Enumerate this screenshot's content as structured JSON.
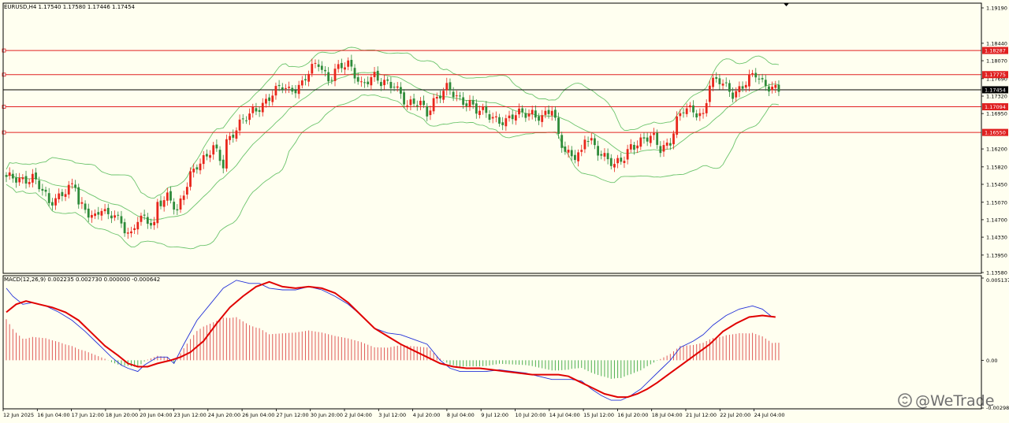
{
  "colors": {
    "background": "#fffff0",
    "border": "#000000",
    "bull": "#e8261c",
    "bear": "#2e8b3a",
    "band": "#6cc46c",
    "level": "#e02020",
    "price_line": "#000000",
    "macd_fast": "#2230d8",
    "macd_slow": "#e00000",
    "hist_pos": "#e05a5a",
    "hist_neg": "#4caf50"
  },
  "watermark": "@WeTrade",
  "watermark_icon": "wetrade-logo-icon",
  "chart_data": [
    {
      "type": "candlestick",
      "header": "EURUSD,H4  1.17540 1.17580 1.17446 1.17454",
      "ylim": [
        1.1358,
        1.1919
      ],
      "y_ticks": [
        "1.19190",
        "1.18440",
        "1.18070",
        "1.17690",
        "1.17320",
        "1.16950",
        "1.16200",
        "1.15820",
        "1.15450",
        "1.15070",
        "1.14700",
        "1.14330",
        "1.13950",
        "1.13580"
      ],
      "levels": [
        {
          "label": "1.18287",
          "value": 1.18287
        },
        {
          "label": "1.17775",
          "value": 1.17775
        },
        {
          "label": "1.17094",
          "value": 1.17094
        },
        {
          "label": "1.16550",
          "value": 1.1655
        }
      ],
      "current_price": {
        "label": "1.17454",
        "value": 1.17454
      },
      "bollinger_bands": true,
      "x_labels": [
        "12 Jun 2025",
        "16 Jun 04:00",
        "17 Jun 12:00",
        "18 Jun 20:00",
        "20 Jun 04:00",
        "23 Jun 12:00",
        "24 Jun 20:00",
        "26 Jun 04:00",
        "27 Jun 12:00",
        "30 Jun 20:00",
        "2 Jul 04:00",
        "3 Jul 12:00",
        "4 Jul 20:00",
        "8 Jul 04:00",
        "9 Jul 12:00",
        "10 Jul 20:00",
        "14 Jul 04:00",
        "15 Jul 12:00",
        "16 Jul 20:00",
        "18 Jul 04:00",
        "21 Jul 12:00",
        "22 Jul 20:00",
        "24 Jul 04:00"
      ],
      "close_path": [
        [
          0,
          1.1555
        ],
        [
          8,
          1.156
        ],
        [
          13,
          1.1505
        ],
        [
          17,
          1.153
        ],
        [
          21,
          1.154
        ],
        [
          22,
          1.15
        ],
        [
          27,
          1.148
        ],
        [
          29,
          1.1495
        ],
        [
          31,
          1.147
        ],
        [
          33,
          1.148
        ],
        [
          38,
          1.144
        ],
        [
          40,
          1.147
        ],
        [
          45,
          1.146
        ],
        [
          46,
          1.151
        ],
        [
          49,
          1.152
        ],
        [
          50,
          1.151
        ],
        [
          52,
          1.148
        ],
        [
          56,
          1.157
        ],
        [
          58,
          1.159
        ],
        [
          61,
          1.16
        ],
        [
          63,
          1.162
        ],
        [
          66,
          1.159
        ],
        [
          67,
          1.164
        ],
        [
          71,
          1.167
        ],
        [
          74,
          1.169
        ],
        [
          75,
          1.17
        ],
        [
          80,
          1.173
        ],
        [
          84,
          1.175
        ],
        [
          86,
          1.1745
        ],
        [
          90,
          1.176
        ],
        [
          92,
          1.178
        ],
        [
          95,
          1.18
        ],
        [
          98,
          1.177
        ],
        [
          100,
          1.179
        ],
        [
          104,
          1.1795
        ],
        [
          108,
          1.176
        ],
        [
          110,
          1.177
        ],
        [
          112,
          1.1772
        ],
        [
          114,
          1.1755
        ],
        [
          118,
          1.176
        ],
        [
          120,
          1.174
        ],
        [
          122,
          1.171
        ],
        [
          126,
          1.1715
        ],
        [
          128,
          1.17
        ],
        [
          130,
          1.1725
        ],
        [
          134,
          1.1745
        ],
        [
          137,
          1.173
        ],
        [
          141,
          1.172
        ],
        [
          143,
          1.17
        ],
        [
          147,
          1.169
        ],
        [
          152,
          1.168
        ],
        [
          157,
          1.1695
        ],
        [
          160,
          1.17
        ],
        [
          163,
          1.1685
        ],
        [
          166,
          1.17
        ],
        [
          168,
          1.165
        ],
        [
          170,
          1.162
        ],
        [
          173,
          1.1605
        ],
        [
          175,
          1.1605
        ],
        [
          176,
          1.164
        ],
        [
          178,
          1.1635
        ],
        [
          180,
          1.162
        ],
        [
          183,
          1.16
        ],
        [
          185,
          1.158
        ],
        [
          188,
          1.16
        ],
        [
          190,
          1.163
        ],
        [
          194,
          1.164
        ],
        [
          197,
          1.164
        ],
        [
          199,
          1.162
        ],
        [
          202,
          1.164
        ],
        [
          204,
          1.168
        ],
        [
          206,
          1.17
        ],
        [
          209,
          1.17
        ],
        [
          212,
          1.1695
        ],
        [
          214,
          1.176
        ],
        [
          217,
          1.176
        ],
        [
          221,
          1.174
        ],
        [
          223,
          1.175
        ],
        [
          226,
          1.1765
        ],
        [
          228,
          1.1775
        ],
        [
          230,
          1.176
        ],
        [
          233,
          1.1755
        ],
        [
          235,
          1.1745
        ]
      ]
    },
    {
      "type": "line",
      "header": "MACD(12,26,9) 0.002235 0.002730 0.000000 -0.000642",
      "ylim": [
        -0.002985,
        0.005137
      ],
      "y_ticks": [
        "0.005137",
        "0.00",
        "-0.002985"
      ],
      "series": [
        {
          "values": [
            [
              0,
              0.0045
            ],
            [
              2,
              0.004
            ],
            [
              5,
              0.0035
            ],
            [
              8,
              0.0036
            ],
            [
              12,
              0.0034
            ],
            [
              16,
              0.003
            ],
            [
              20,
              0.0025
            ],
            [
              24,
              0.0018
            ],
            [
              28,
              0.001
            ],
            [
              32,
              0.0002
            ],
            [
              35,
              -0.0003
            ],
            [
              37,
              -0.0005
            ],
            [
              40,
              -0.0007
            ],
            [
              42,
              -0.0003
            ],
            [
              46,
              0.0002
            ],
            [
              49,
              0.0002
            ],
            [
              51,
              -0.0002
            ],
            [
              54,
              0.001
            ],
            [
              58,
              0.0025
            ],
            [
              62,
              0.0035
            ],
            [
              66,
              0.0045
            ],
            [
              70,
              0.005
            ],
            [
              74,
              0.0048
            ],
            [
              77,
              0.0048
            ],
            [
              80,
              0.0045
            ],
            [
              84,
              0.0044
            ],
            [
              88,
              0.0044
            ],
            [
              92,
              0.0046
            ],
            [
              96,
              0.0044
            ],
            [
              100,
              0.004
            ],
            [
              104,
              0.0035
            ],
            [
              108,
              0.0028
            ],
            [
              112,
              0.002
            ],
            [
              116,
              0.0017
            ],
            [
              120,
              0.0016
            ],
            [
              124,
              0.0013
            ],
            [
              128,
              0.001
            ],
            [
              132,
              0.0
            ],
            [
              135,
              -0.0005
            ],
            [
              138,
              -0.0007
            ],
            [
              142,
              -0.0007
            ],
            [
              146,
              -0.0007
            ],
            [
              150,
              -0.0006
            ],
            [
              154,
              -0.0007
            ],
            [
              158,
              -0.0008
            ],
            [
              162,
              -0.001
            ],
            [
              166,
              -0.0012
            ],
            [
              169,
              -0.0012
            ],
            [
              172,
              -0.0012
            ],
            [
              175,
              -0.0013
            ],
            [
              178,
              -0.0018
            ],
            [
              181,
              -0.0022
            ],
            [
              184,
              -0.0025
            ],
            [
              187,
              -0.0025
            ],
            [
              190,
              -0.0022
            ],
            [
              193,
              -0.0018
            ],
            [
              196,
              -0.0012
            ],
            [
              199,
              -0.0006
            ],
            [
              202,
              0.0
            ],
            [
              205,
              0.0008
            ],
            [
              209,
              0.0012
            ],
            [
              212,
              0.0016
            ],
            [
              215,
              0.0022
            ],
            [
              219,
              0.0028
            ],
            [
              223,
              0.0032
            ],
            [
              227,
              0.0034
            ],
            [
              230,
              0.0032
            ],
            [
              233,
              0.0027
            ]
          ]
        },
        {
          "values": [
            [
              0,
              0.003
            ],
            [
              3,
              0.0035
            ],
            [
              6,
              0.0037
            ],
            [
              10,
              0.0035
            ],
            [
              14,
              0.0033
            ],
            [
              18,
              0.003
            ],
            [
              22,
              0.0025
            ],
            [
              26,
              0.0017
            ],
            [
              30,
              0.0009
            ],
            [
              34,
              0.0003
            ],
            [
              37,
              -0.0002
            ],
            [
              40,
              -0.0004
            ],
            [
              43,
              -0.0004
            ],
            [
              46,
              -0.0002
            ],
            [
              50,
              0.0
            ],
            [
              53,
              0.0002
            ],
            [
              56,
              0.0005
            ],
            [
              60,
              0.0012
            ],
            [
              64,
              0.0023
            ],
            [
              68,
              0.0033
            ],
            [
              72,
              0.004
            ],
            [
              76,
              0.0046
            ],
            [
              80,
              0.0049
            ],
            [
              84,
              0.0046
            ],
            [
              88,
              0.0045
            ],
            [
              92,
              0.0046
            ],
            [
              96,
              0.0045
            ],
            [
              100,
              0.0042
            ],
            [
              104,
              0.0036
            ],
            [
              108,
              0.0028
            ],
            [
              112,
              0.002
            ],
            [
              116,
              0.0015
            ],
            [
              120,
              0.001
            ],
            [
              124,
              0.0006
            ],
            [
              128,
              0.0002
            ],
            [
              132,
              -0.0002
            ],
            [
              136,
              -0.0004
            ],
            [
              140,
              -0.0005
            ],
            [
              144,
              -0.0005
            ],
            [
              148,
              -0.0006
            ],
            [
              152,
              -0.0007
            ],
            [
              156,
              -0.0008
            ],
            [
              160,
              -0.0009
            ],
            [
              164,
              -0.0009
            ],
            [
              168,
              -0.0009
            ],
            [
              171,
              -0.001
            ],
            [
              174,
              -0.0013
            ],
            [
              178,
              -0.0017
            ],
            [
              182,
              -0.0021
            ],
            [
              186,
              -0.0023
            ],
            [
              189,
              -0.0023
            ],
            [
              192,
              -0.0021
            ],
            [
              195,
              -0.0018
            ],
            [
              198,
              -0.0014
            ],
            [
              202,
              -0.0008
            ],
            [
              206,
              -0.0002
            ],
            [
              210,
              0.0004
            ],
            [
              214,
              0.001
            ],
            [
              218,
              0.0018
            ],
            [
              222,
              0.0023
            ],
            [
              226,
              0.0027
            ],
            [
              230,
              0.0028
            ],
            [
              234,
              0.0027
            ]
          ]
        }
      ],
      "histogram_count": 236
    }
  ]
}
